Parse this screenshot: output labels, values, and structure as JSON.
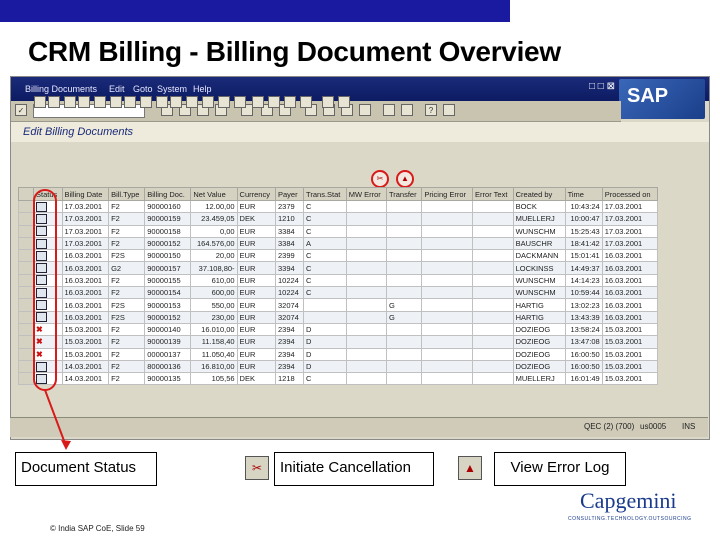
{
  "slide": {
    "title": "CRM Billing - Billing Document Overview",
    "footer": "© India SAP CoE, Slide 59",
    "logo_text": "Capgemini",
    "logo_tagline": "CONSULTING.TECHNOLOGY.OUTSOURCING",
    "accent_color": "#1a1aa0"
  },
  "sap": {
    "menu": [
      "Billing Documents",
      "Edit",
      "Goto",
      "System",
      "Help"
    ],
    "brand": "SAP",
    "window_buttons": "□ □ ⊠",
    "screen_title": "Edit Billing Documents",
    "status_bar": {
      "client": "QEC (2) (700)",
      "server": "us0005",
      "mode": "INS"
    }
  },
  "grid": {
    "columns": [
      "Status",
      "Billing Date",
      "Bill.Type",
      "Billing Doc.",
      "Net Value",
      "Currency",
      "Payer",
      "Trans.Stat",
      "MW Error",
      "Transfer",
      "Pricing Error",
      "Error Text",
      "Created by",
      "Time",
      "Processed on"
    ],
    "rows": [
      {
        "status": "ok",
        "date": "17.03.2001",
        "type": "F2",
        "doc": "90000160",
        "net": "12.00,00",
        "cur": "EUR",
        "payer": "2379",
        "trans": "C",
        "mw": "",
        "transfer": "",
        "price": "",
        "err": "",
        "by": "BOCK",
        "time": "10:43:24",
        "proc": "17.03.2001"
      },
      {
        "status": "ok",
        "date": "17.03.2001",
        "type": "F2",
        "doc": "90000159",
        "net": "23.459,05",
        "cur": "DEK",
        "payer": "1210",
        "trans": "C",
        "mw": "",
        "transfer": "",
        "price": "",
        "err": "",
        "by": "MUELLERJ",
        "time": "10:00:47",
        "proc": "17.03.2001"
      },
      {
        "status": "ok",
        "date": "17.03.2001",
        "type": "F2",
        "doc": "90000158",
        "net": "0,00",
        "cur": "EUR",
        "payer": "3384",
        "trans": "C",
        "mw": "",
        "transfer": "",
        "price": "",
        "err": "",
        "by": "WUNSCHM",
        "time": "15:25:43",
        "proc": "17.03.2001"
      },
      {
        "status": "ok",
        "date": "17.03.2001",
        "type": "F2",
        "doc": "90000152",
        "net": "164.576,00",
        "cur": "EUR",
        "payer": "3384",
        "trans": "A",
        "mw": "",
        "transfer": "",
        "price": "",
        "err": "",
        "by": "BAUSCHR",
        "time": "18:41:42",
        "proc": "17.03.2001"
      },
      {
        "status": "ok",
        "date": "16.03.2001",
        "type": "F2S",
        "doc": "90000150",
        "net": "20,00",
        "cur": "EUR",
        "payer": "2399",
        "trans": "C",
        "mw": "",
        "transfer": "",
        "price": "",
        "err": "",
        "by": "DACKMANN",
        "time": "15:01:41",
        "proc": "16.03.2001"
      },
      {
        "status": "ok",
        "date": "16.03.2001",
        "type": "G2",
        "doc": "90000157",
        "net": "37.108,80-",
        "cur": "EUR",
        "payer": "3394",
        "trans": "C",
        "mw": "",
        "transfer": "",
        "price": "",
        "err": "",
        "by": "LOCKINSS",
        "time": "14:49:37",
        "proc": "16.03.2001"
      },
      {
        "status": "ok",
        "date": "16.03.2001",
        "type": "F2",
        "doc": "90000155",
        "net": "610,00",
        "cur": "EUR",
        "payer": "10224",
        "trans": "C",
        "mw": "",
        "transfer": "",
        "price": "",
        "err": "",
        "by": "WUNSCHM",
        "time": "14:14:23",
        "proc": "16.03.2001"
      },
      {
        "status": "ok",
        "date": "16.03.2001",
        "type": "F2",
        "doc": "90000154",
        "net": "600,00",
        "cur": "EUR",
        "payer": "10224",
        "trans": "C",
        "mw": "",
        "transfer": "",
        "price": "",
        "err": "",
        "by": "WUNSCHM",
        "time": "10:59:44",
        "proc": "16.03.2001"
      },
      {
        "status": "ok",
        "date": "16.03.2001",
        "type": "F2S",
        "doc": "90000153",
        "net": "550,00",
        "cur": "EUR",
        "payer": "32074",
        "trans": "",
        "mw": "",
        "transfer": "G",
        "price": "",
        "err": "",
        "by": "HARTIG",
        "time": "13:02:23",
        "proc": "16.03.2001"
      },
      {
        "status": "ok",
        "date": "16.03.2001",
        "type": "F2S",
        "doc": "90000152",
        "net": "230,00",
        "cur": "EUR",
        "payer": "32074",
        "trans": "",
        "mw": "",
        "transfer": "G",
        "price": "",
        "err": "",
        "by": "HARTIG",
        "time": "13:43:39",
        "proc": "16.03.2001"
      },
      {
        "status": "x",
        "date": "15.03.2001",
        "type": "F2",
        "doc": "90000140",
        "net": "16.010,00",
        "cur": "EUR",
        "payer": "2394",
        "trans": "D",
        "mw": "",
        "transfer": "",
        "price": "",
        "err": "",
        "by": "DOZIEOG",
        "time": "13:58:24",
        "proc": "15.03.2001"
      },
      {
        "status": "x",
        "date": "15.03.2001",
        "type": "F2",
        "doc": "90000139",
        "net": "11.158,40",
        "cur": "EUR",
        "payer": "2394",
        "trans": "D",
        "mw": "",
        "transfer": "",
        "price": "",
        "err": "",
        "by": "DOZIEOG",
        "time": "13:47:08",
        "proc": "15.03.2001"
      },
      {
        "status": "x",
        "date": "15.03.2001",
        "type": "F2",
        "doc": "00000137",
        "net": "11.050,40",
        "cur": "EUR",
        "payer": "2394",
        "trans": "D",
        "mw": "",
        "transfer": "",
        "price": "",
        "err": "",
        "by": "DOZIEOG",
        "time": "16:00:50",
        "proc": "15.03.2001"
      },
      {
        "status": "ok",
        "date": "14.03.2001",
        "type": "F2",
        "doc": "80000136",
        "net": "16.810,00",
        "cur": "EUR",
        "payer": "2394",
        "trans": "D",
        "mw": "",
        "transfer": "",
        "price": "",
        "err": "",
        "by": "DOZIEOG",
        "time": "16:00:50",
        "proc": "15.03.2001"
      },
      {
        "status": "ok",
        "date": "14.03.2001",
        "type": "F2",
        "doc": "90000135",
        "net": "105,56",
        "cur": "DEK",
        "payer": "1218",
        "trans": "C",
        "mw": "",
        "transfer": "",
        "price": "",
        "err": "",
        "by": "MUELLERJ",
        "time": "16:01:49",
        "proc": "15.03.2001"
      }
    ]
  },
  "legend": {
    "doc_status": "Document Status",
    "cancel": "Initiate Cancellation",
    "error_log": "View Error Log"
  },
  "colors": {
    "highlight": "#d81a1a",
    "sap_menu": "#0c1b62"
  }
}
